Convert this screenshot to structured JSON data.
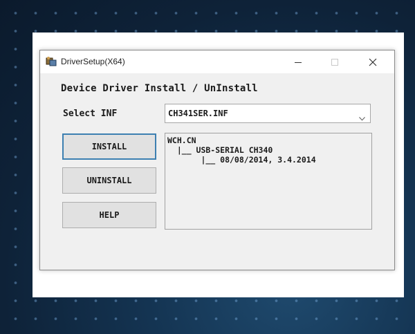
{
  "window": {
    "title": "DriverSetup(X64)",
    "icon": "driver-setup-app-icon",
    "controls": {
      "minimize": "minimize-icon",
      "maximize": "maximize-icon",
      "close": "close-icon"
    }
  },
  "heading": "Device Driver Install / UnInstall",
  "select": {
    "label": "Select INF",
    "value": "CH341SER.INF"
  },
  "buttons": {
    "install": "INSTALL",
    "uninstall": "UNINSTALL",
    "help": "HELP"
  },
  "info": {
    "lines": [
      "WCH.CN",
      "  |__ USB-SERIAL CH340",
      "       |__ 08/08/2014, 3.4.2014"
    ]
  },
  "colors": {
    "background": "#0e2238",
    "window_face": "#f0f0f0",
    "default_button_border": "#3c7fb1"
  }
}
